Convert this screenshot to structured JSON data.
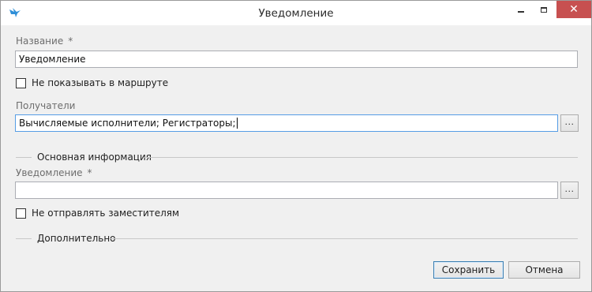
{
  "window": {
    "title": "Уведомление",
    "close_glyph": "✕"
  },
  "form": {
    "name_label": "Название",
    "required_mark": "*",
    "name_value": "Уведомление",
    "hide_in_route_label": "Не показывать в маршруте",
    "hide_in_route_checked": false,
    "recipients_label": "Получатели",
    "recipients_value": "Вычисляемые исполнители; Регистраторы;",
    "browse_glyph": "...",
    "main_section_title": "Основная информация",
    "notification_label": "Уведомление",
    "notification_value": "",
    "no_deputies_label": "Не отправлять заместителям",
    "no_deputies_checked": false,
    "extra_section_title": "Дополнительно"
  },
  "footer": {
    "save_label": "Сохранить",
    "cancel_label": "Отмена"
  },
  "colors": {
    "close_button": "#c75050",
    "focus_border": "#569de5",
    "app_icon": "#2f8fd8"
  },
  "icons": {
    "app": "bird-logo-icon",
    "minimize": "minimize-icon",
    "maximize": "maximize-icon",
    "close": "close-icon"
  }
}
